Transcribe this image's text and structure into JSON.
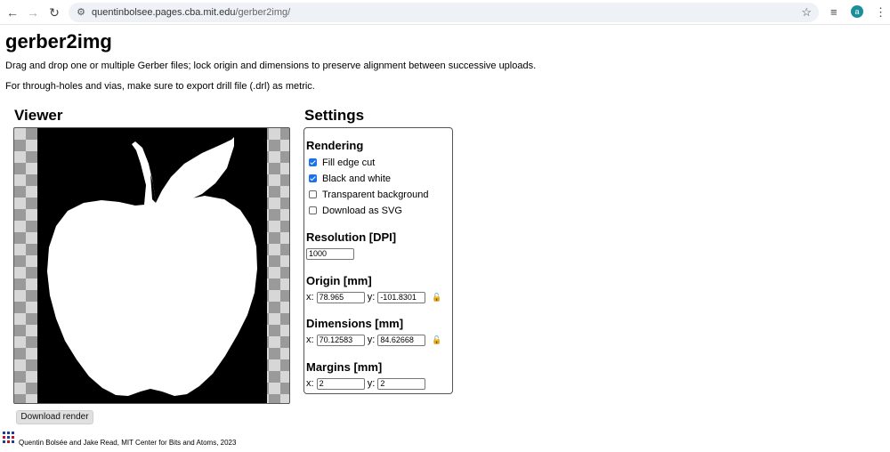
{
  "browser": {
    "url_host": "quentinbolsee.pages.cba.mit.edu",
    "url_path": "/gerber2img/",
    "avatar_letter": "a",
    "icons": [
      "back-icon",
      "forward-icon",
      "reload-icon",
      "site-info-icon",
      "star-icon",
      "reading-list-icon",
      "menu-icon"
    ]
  },
  "page": {
    "title": "gerber2img",
    "description1": "Drag and drop one or multiple Gerber files; lock origin and dimensions to preserve alignment between successive uploads.",
    "description2": "For through-holes and vias, make sure to export drill file (.drl) as metric."
  },
  "viewer": {
    "heading": "Viewer",
    "download_label": "Download render"
  },
  "settings": {
    "heading": "Settings",
    "rendering": {
      "heading": "Rendering",
      "options": [
        {
          "label": "Fill edge cut",
          "checked": true
        },
        {
          "label": "Black and white",
          "checked": true
        },
        {
          "label": "Transparent background",
          "checked": false
        },
        {
          "label": "Download as SVG",
          "checked": false
        }
      ]
    },
    "resolution": {
      "heading": "Resolution [DPI]",
      "value": "1000"
    },
    "origin": {
      "heading": "Origin [mm]",
      "x_label": "x:",
      "x": "78.965",
      "y_label": "y:",
      "y": "-101.8301"
    },
    "dimensions": {
      "heading": "Dimensions [mm]",
      "x_label": "x:",
      "x": "70.12583",
      "y_label": "y:",
      "y": "84.62668"
    },
    "margins": {
      "heading": "Margins [mm]",
      "x_label": "x:",
      "x": "2",
      "y_label": "y:",
      "y": "2"
    }
  },
  "footer": {
    "text": "Quentin Bolsée and Jake Read, MIT Center for Bits and Atoms, 2023",
    "logo_colors": [
      "#1c3f94",
      "#c8102e"
    ]
  }
}
